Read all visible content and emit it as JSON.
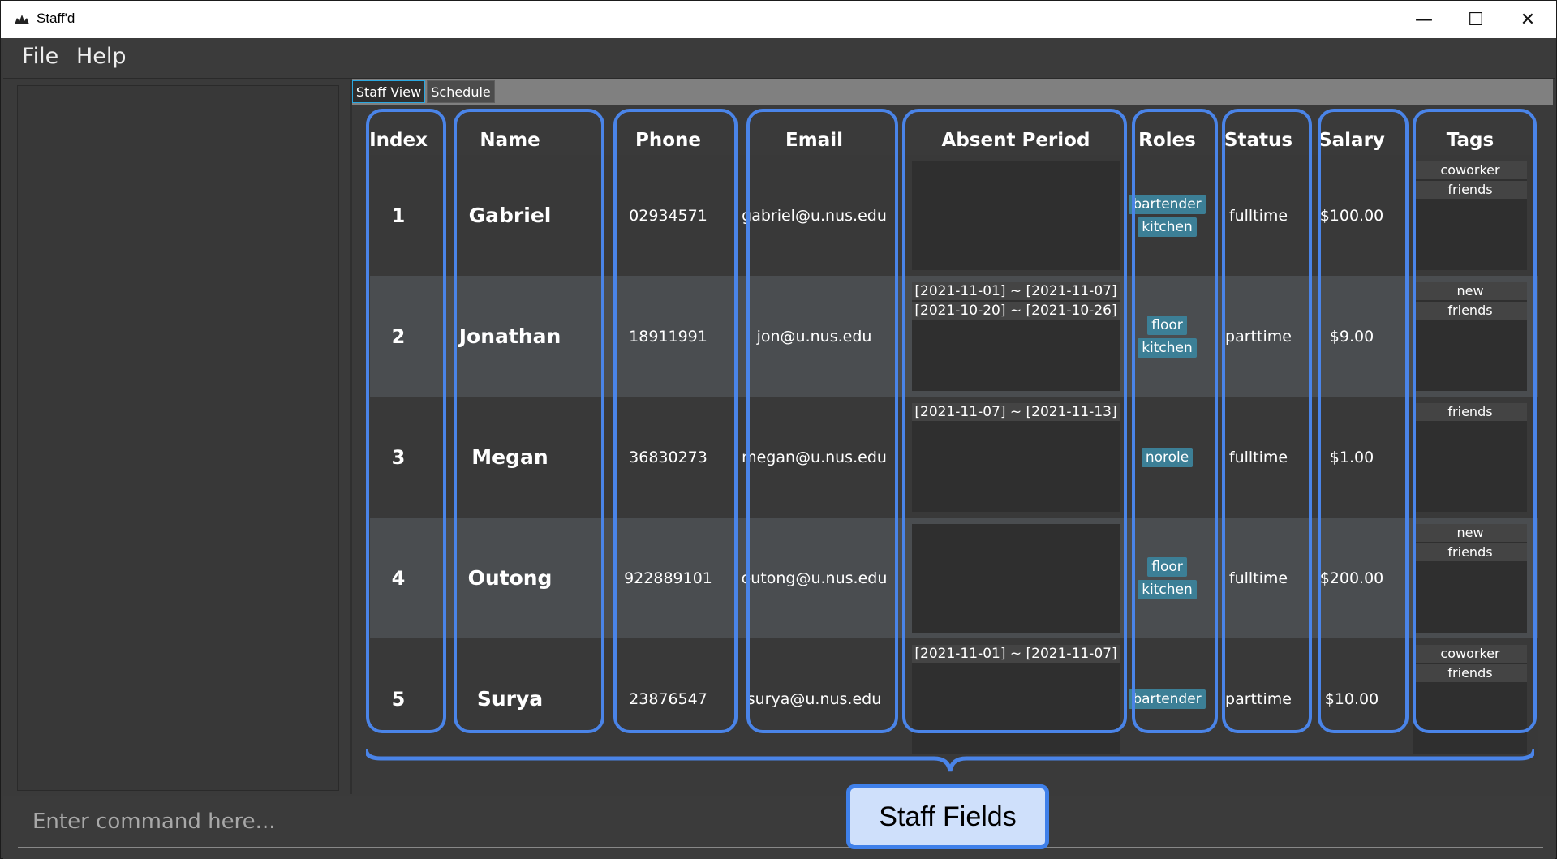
{
  "window": {
    "title": "Staff'd",
    "min_glyph": "—",
    "max_glyph": "☐",
    "close_glyph": "✕"
  },
  "menu": [
    "File",
    "Help"
  ],
  "tabs": [
    "Staff View",
    "Schedule"
  ],
  "columns": [
    "Index",
    "Name",
    "Phone",
    "Email",
    "Absent Period",
    "Roles",
    "Status",
    "Salary",
    "Tags"
  ],
  "rows": [
    {
      "index": "1",
      "name": "Gabriel",
      "phone": "02934571",
      "email": "gabriel@u.nus.edu",
      "absent": [],
      "roles": [
        "bartender",
        "kitchen"
      ],
      "status": "fulltime",
      "salary": "$100.00",
      "tags": [
        "coworker",
        "friends"
      ]
    },
    {
      "index": "2",
      "name": "Jonathan",
      "phone": "18911991",
      "email": "jon@u.nus.edu",
      "absent": [
        "[2021-11-01] ~ [2021-11-07]",
        "[2021-10-20] ~ [2021-10-26]"
      ],
      "roles": [
        "floor",
        "kitchen"
      ],
      "status": "parttime",
      "salary": "$9.00",
      "tags": [
        "new",
        "friends"
      ]
    },
    {
      "index": "3",
      "name": "Megan",
      "phone": "36830273",
      "email": "megan@u.nus.edu",
      "absent": [
        "[2021-11-07] ~ [2021-11-13]"
      ],
      "roles": [
        "norole"
      ],
      "status": "fulltime",
      "salary": "$1.00",
      "tags": [
        "friends"
      ]
    },
    {
      "index": "4",
      "name": "Outong",
      "phone": "922889101",
      "email": "outong@u.nus.edu",
      "absent": [],
      "roles": [
        "floor",
        "kitchen"
      ],
      "status": "fulltime",
      "salary": "$200.00",
      "tags": [
        "new",
        "friends"
      ]
    },
    {
      "index": "5",
      "name": "Surya",
      "phone": "23876547",
      "email": "surya@u.nus.edu",
      "absent": [
        "[2021-11-01] ~ [2021-11-07]"
      ],
      "roles": [
        "bartender"
      ],
      "status": "parttime",
      "salary": "$10.00",
      "tags": [
        "coworker",
        "friends"
      ]
    }
  ],
  "annotation": {
    "label": "Staff Fields",
    "outline_color": "#4a84e8"
  },
  "command": {
    "placeholder": "Enter command here..."
  },
  "colors": {
    "role_badge": "#3c7f96",
    "active_tab_border": "#2aa7e0"
  }
}
